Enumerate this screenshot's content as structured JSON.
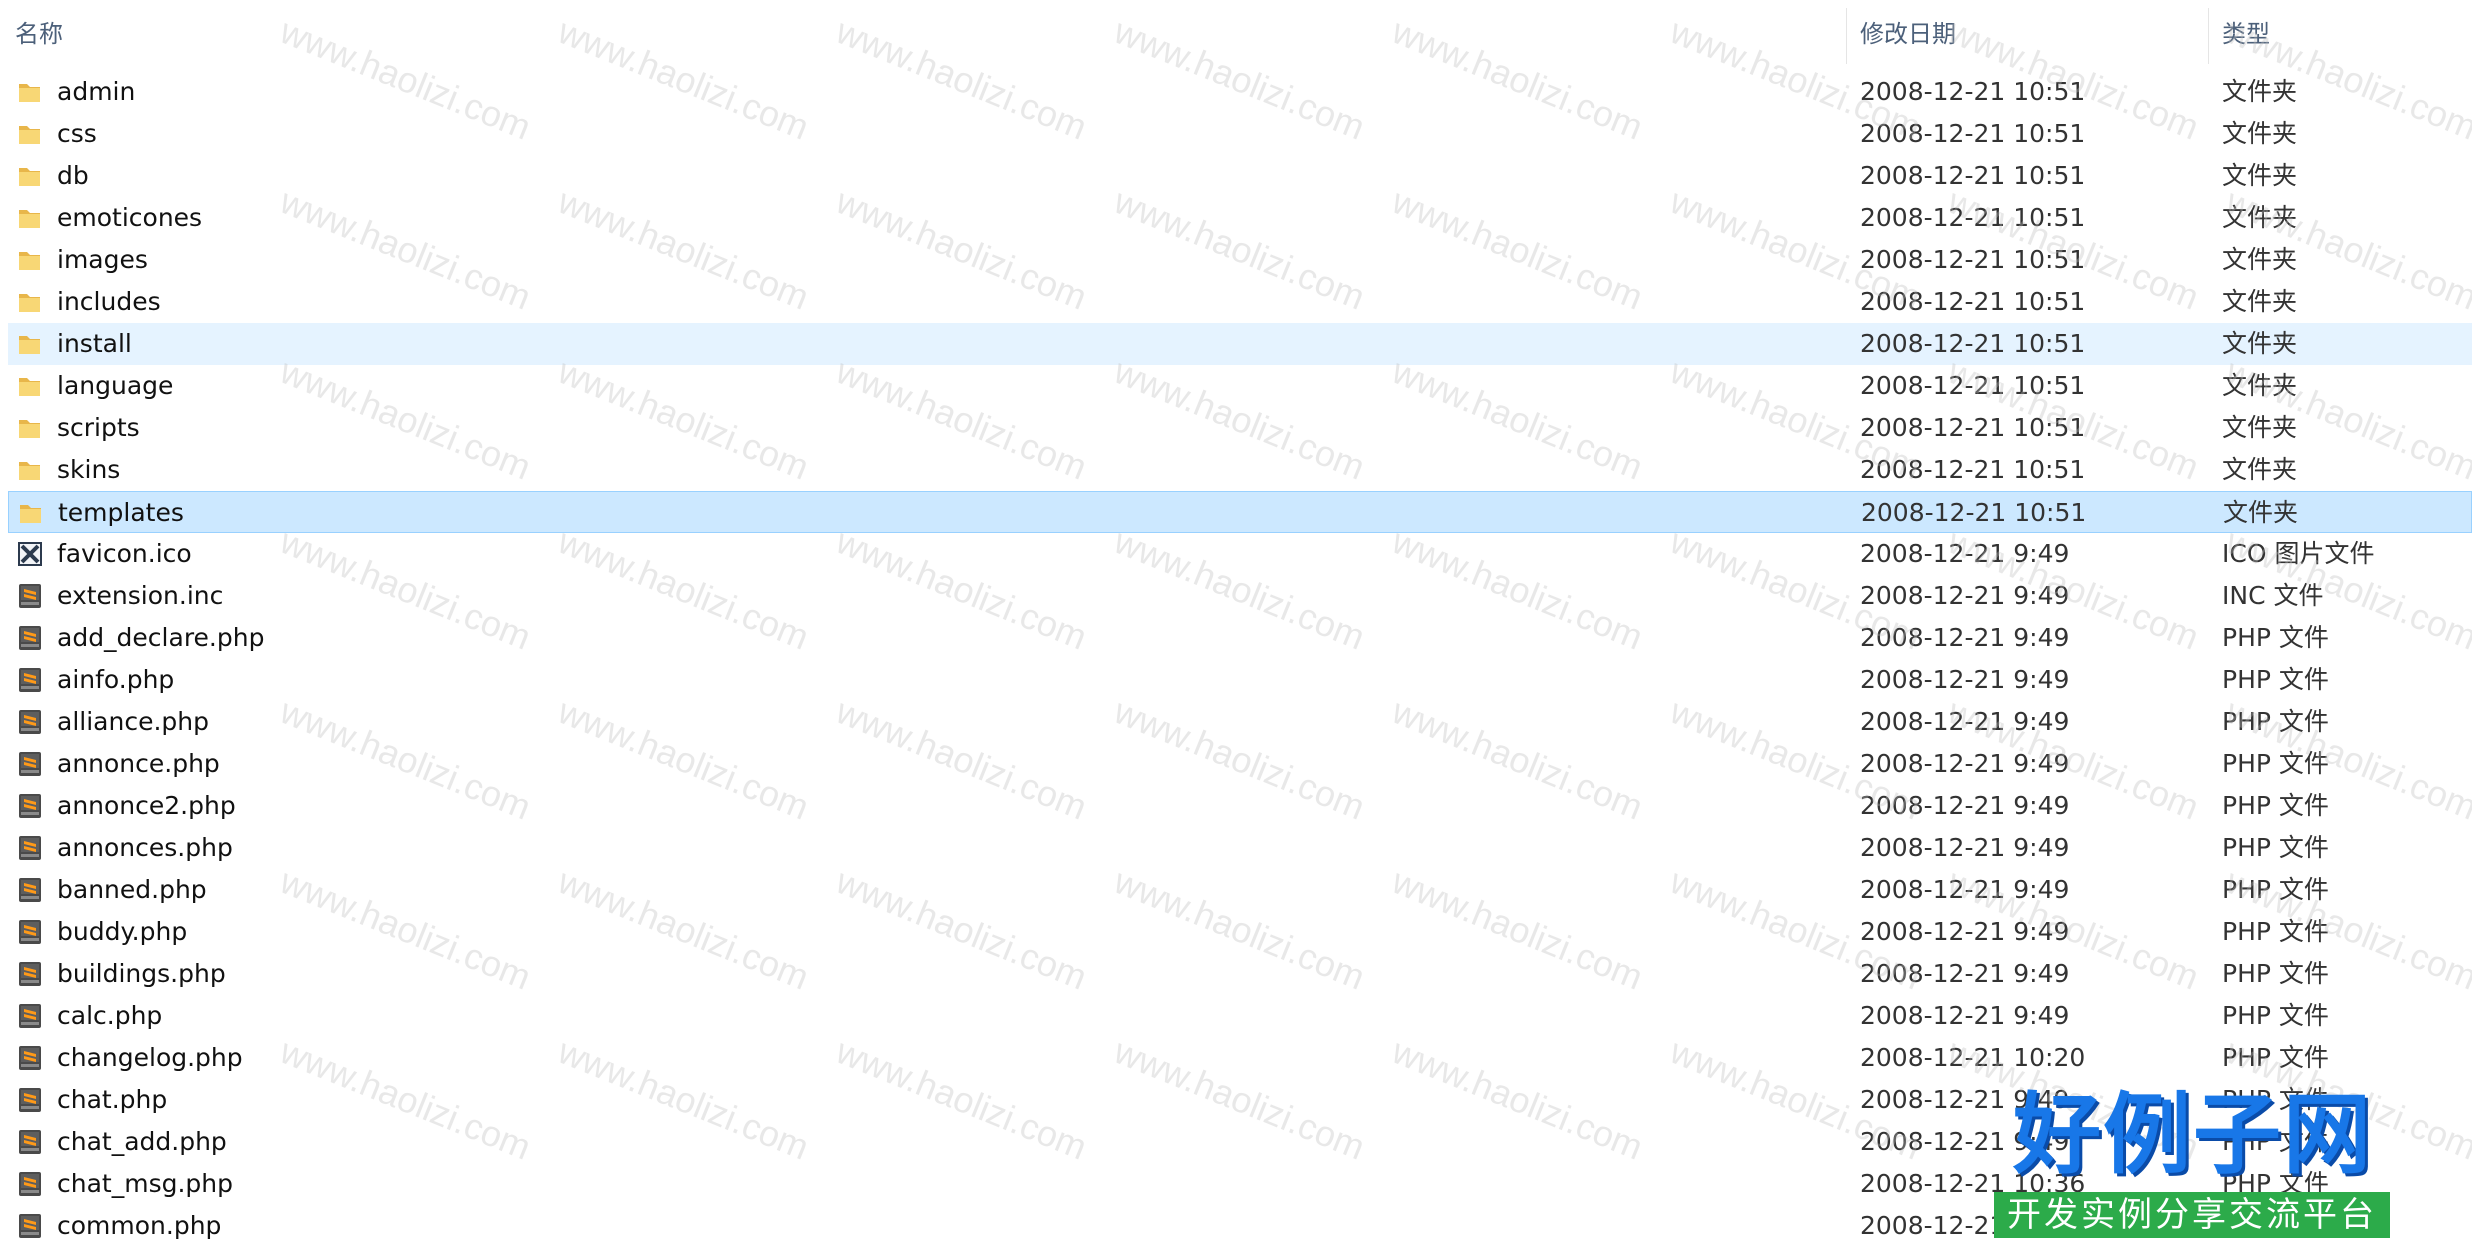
{
  "columns": {
    "name": "名称",
    "date": "修改日期",
    "type": "类型"
  },
  "rows": [
    {
      "name": "admin",
      "date": "2008-12-21 10:51",
      "type": "文件夹",
      "icon": "folder-icon"
    },
    {
      "name": "css",
      "date": "2008-12-21 10:51",
      "type": "文件夹",
      "icon": "folder-icon"
    },
    {
      "name": "db",
      "date": "2008-12-21 10:51",
      "type": "文件夹",
      "icon": "folder-icon"
    },
    {
      "name": "emoticones",
      "date": "2008-12-21 10:51",
      "type": "文件夹",
      "icon": "folder-icon"
    },
    {
      "name": "images",
      "date": "2008-12-21 10:51",
      "type": "文件夹",
      "icon": "folder-icon"
    },
    {
      "name": "includes",
      "date": "2008-12-21 10:51",
      "type": "文件夹",
      "icon": "folder-icon"
    },
    {
      "name": "install",
      "date": "2008-12-21 10:51",
      "type": "文件夹",
      "icon": "folder-icon",
      "state": "hover"
    },
    {
      "name": "language",
      "date": "2008-12-21 10:51",
      "type": "文件夹",
      "icon": "folder-icon"
    },
    {
      "name": "scripts",
      "date": "2008-12-21 10:51",
      "type": "文件夹",
      "icon": "folder-icon"
    },
    {
      "name": "skins",
      "date": "2008-12-21 10:51",
      "type": "文件夹",
      "icon": "folder-icon"
    },
    {
      "name": "templates",
      "date": "2008-12-21 10:51",
      "type": "文件夹",
      "icon": "folder-icon",
      "state": "selected"
    },
    {
      "name": "favicon.ico",
      "date": "2008-12-21 9:49",
      "type": "ICO 图片文件",
      "icon": "ico-file-icon"
    },
    {
      "name": "extension.inc",
      "date": "2008-12-21 9:49",
      "type": "INC 文件",
      "icon": "sublime-file-icon"
    },
    {
      "name": "add_declare.php",
      "date": "2008-12-21 9:49",
      "type": "PHP 文件",
      "icon": "sublime-file-icon"
    },
    {
      "name": "ainfo.php",
      "date": "2008-12-21 9:49",
      "type": "PHP 文件",
      "icon": "sublime-file-icon"
    },
    {
      "name": "alliance.php",
      "date": "2008-12-21 9:49",
      "type": "PHP 文件",
      "icon": "sublime-file-icon"
    },
    {
      "name": "annonce.php",
      "date": "2008-12-21 9:49",
      "type": "PHP 文件",
      "icon": "sublime-file-icon"
    },
    {
      "name": "annonce2.php",
      "date": "2008-12-21 9:49",
      "type": "PHP 文件",
      "icon": "sublime-file-icon"
    },
    {
      "name": "annonces.php",
      "date": "2008-12-21 9:49",
      "type": "PHP 文件",
      "icon": "sublime-file-icon"
    },
    {
      "name": "banned.php",
      "date": "2008-12-21 9:49",
      "type": "PHP 文件",
      "icon": "sublime-file-icon"
    },
    {
      "name": "buddy.php",
      "date": "2008-12-21 9:49",
      "type": "PHP 文件",
      "icon": "sublime-file-icon"
    },
    {
      "name": "buildings.php",
      "date": "2008-12-21 9:49",
      "type": "PHP 文件",
      "icon": "sublime-file-icon"
    },
    {
      "name": "calc.php",
      "date": "2008-12-21 9:49",
      "type": "PHP 文件",
      "icon": "sublime-file-icon"
    },
    {
      "name": "changelog.php",
      "date": "2008-12-21 10:20",
      "type": "PHP 文件",
      "icon": "sublime-file-icon"
    },
    {
      "name": "chat.php",
      "date": "2008-12-21 9:49",
      "type": "PHP 文件",
      "icon": "sublime-file-icon"
    },
    {
      "name": "chat_add.php",
      "date": "2008-12-21 9:49",
      "type": "PHP 文件",
      "icon": "sublime-file-icon"
    },
    {
      "name": "chat_msg.php",
      "date": "2008-12-21 10:36",
      "type": "PHP 文件",
      "icon": "sublime-file-icon"
    },
    {
      "name": "common.php",
      "date": "2008-12-21",
      "type": "",
      "icon": "sublime-file-icon"
    }
  ],
  "watermark": {
    "text": "www.haolizi.com"
  },
  "logo": {
    "title": "好例子网",
    "subtitle": "开发实例分享交流平台"
  },
  "colors": {
    "hover_bg": "#e5f3ff",
    "selected_bg": "#cce8ff",
    "selected_border": "#99d1ff",
    "header_text": "#4c607a",
    "folder": "#f8c75a",
    "logo_blue": "#1877e8",
    "logo_green": "#2cab4a"
  }
}
